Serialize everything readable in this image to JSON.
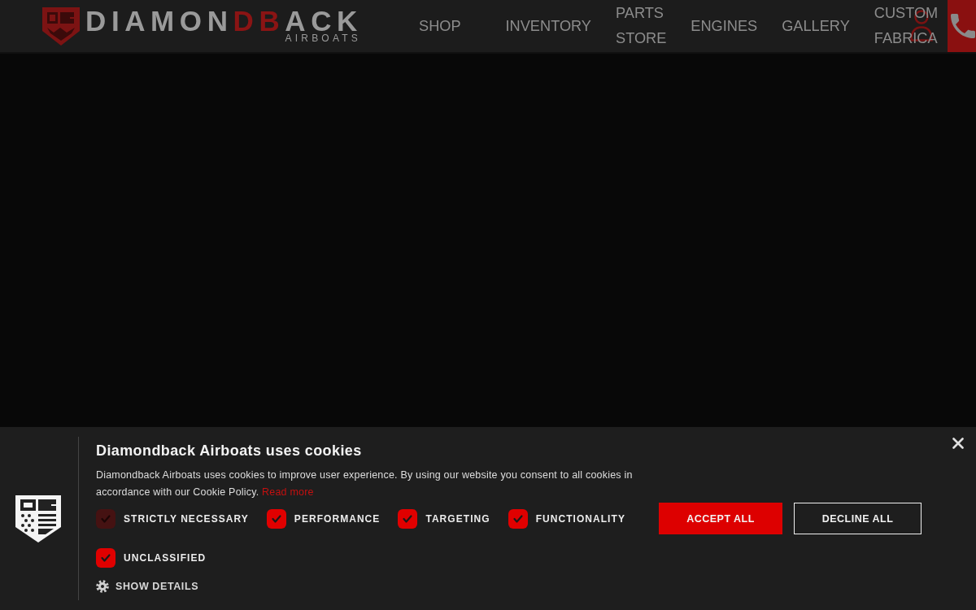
{
  "header": {
    "logo": {
      "wordmark": "DIAMON**DB**ACK",
      "tagline": "AIRBOATS"
    },
    "nav": [
      {
        "label": "SHOP"
      },
      {
        "label": "INVENTORY"
      },
      {
        "label": "PARTS STORE"
      },
      {
        "label": "ENGINES"
      },
      {
        "label": "GALLERY"
      },
      {
        "label": "CUSTOM FABRICA"
      }
    ]
  },
  "cookie_banner": {
    "title": "Diamondback Airboats uses cookies",
    "text": "Diamondback Airboats uses cookies to improve user experience. By using our website you consent to all cookies in accordance with our Cookie Policy.",
    "link": "Read more",
    "categories": [
      {
        "label": "STRICTLY NECESSARY",
        "checked": true,
        "disabled": true
      },
      {
        "label": "PERFORMANCE",
        "checked": true,
        "disabled": false
      },
      {
        "label": "TARGETING",
        "checked": true,
        "disabled": false
      },
      {
        "label": "FUNCTIONALITY",
        "checked": true,
        "disabled": false
      },
      {
        "label": "UNCLASSIFIED",
        "checked": true,
        "disabled": false
      }
    ],
    "show_details": "SHOW DETAILS",
    "buttons": [
      {
        "label": "ACCEPT ALL",
        "kind": "primary"
      },
      {
        "label": "DECLINE ALL",
        "kind": "outline"
      }
    ]
  }
}
